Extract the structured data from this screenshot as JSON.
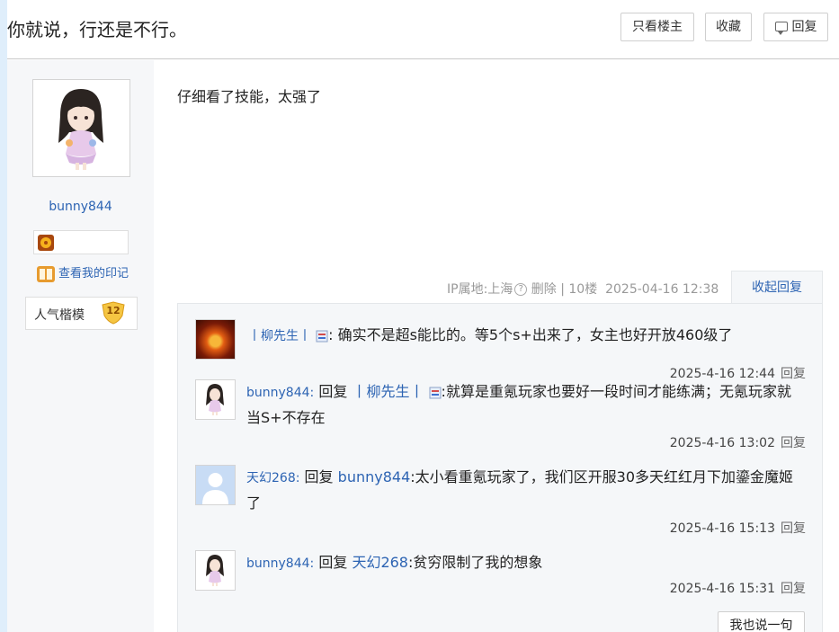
{
  "thread": {
    "title": "你就说，行还是不行。"
  },
  "toolbar": {
    "only_op": "只看楼主",
    "favorite": "收藏",
    "reply": "回复"
  },
  "author": {
    "username": "bunny844",
    "mark_link": "查看我的印记",
    "popularity_label": "人气楷模",
    "popularity_level": "12"
  },
  "post": {
    "content": "仔细看了技能，太强了",
    "ip_location": "IP属地:上海",
    "delete": "删除",
    "separator": "|",
    "floor": "10楼",
    "time": "2025-04-16 12:38",
    "collapse": "收起回复"
  },
  "replies": [
    {
      "user": "丨柳先生丨",
      "reply_word": "",
      "to": "",
      "text": ": 确实不是超s能比的。等5个s+出来了，女主也好开放460级了",
      "time": "2025-4-16 12:44",
      "action": "回复"
    },
    {
      "user": "bunny844:",
      "reply_word": "回复",
      "to": "丨柳先生丨",
      "text": ":就算是重氪玩家也要好一段时间才能练满；无氪玩家就当S+不存在",
      "time": "2025-4-16 13:02",
      "action": "回复"
    },
    {
      "user": "天幻268:",
      "reply_word": "回复",
      "to": "bunny844",
      "text": ":太小看重氪玩家了，我们区开服30多天红红月下加鎏金魔姬了",
      "time": "2025-4-16 15:13",
      "action": "回复"
    },
    {
      "user": "bunny844:",
      "reply_word": "回复",
      "to": "天幻268",
      "text": ":贫穷限制了我的想象",
      "time": "2025-4-16 15:31",
      "action": "回复"
    }
  ],
  "say_button": "我也说一句",
  "colors": {
    "link": "#2d64b3",
    "sidebar_bg": "#f6f7f9",
    "reply_bg": "#f5f7f9"
  }
}
